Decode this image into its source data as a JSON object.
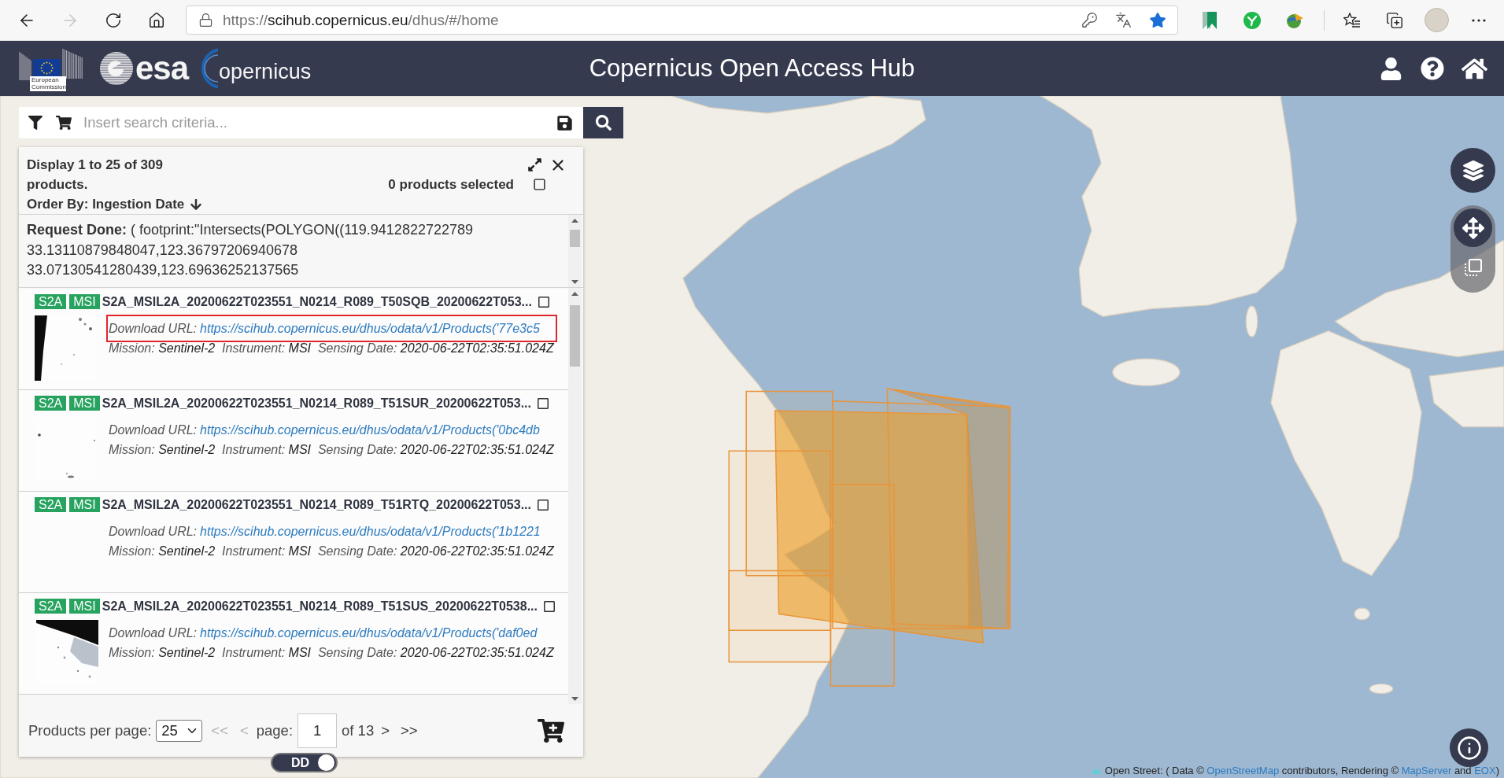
{
  "browser": {
    "back_disabled": false,
    "forward_disabled": true,
    "address": "https://**scihub.copernicus.eu**/dhus/#/home",
    "favorited": true
  },
  "header": {
    "ec_caption": "European Commission",
    "esa_wordmark": "esa",
    "copernicus_wordmark": "opernicus",
    "title": "Copernicus Open Access Hub"
  },
  "search": {
    "placeholder": "Insert search criteria..."
  },
  "results": {
    "summary": "Display 1 to 25 of 309 products.",
    "order_by": "Order By: Ingestion Date",
    "selected_count": "0 products selected",
    "select_all_checked": false,
    "request": "**Request Done:** ( footprint:\"Intersects(POLYGON((119.9412822722789 33.13110879848047,123.36797206940678 33.07130541280439,123.69636252137565",
    "products": [
      {
        "tags": [
          "S2A",
          "MSI"
        ],
        "name": "S2A_MSIL2A_20200622T023551_N0214_R089_T50SQB_20200622T053...",
        "checked": false,
        "thumbnail": {
          "kind": "left-strip"
        },
        "highlighted": true,
        "download_label": "Download URL:",
        "download_url": "https://scihub.copernicus.eu/dhus/odata/v1/Products('77e3c5",
        "details": "Mission: **Sentinel-2**  Instrument: **MSI**  Sensing Date: **2020-06-22T02:35:51.024Z**"
      },
      {
        "tags": [
          "S2A",
          "MSI"
        ],
        "name": "S2A_MSIL2A_20200622T023551_N0214_R089_T51SUR_20200622T053...",
        "checked": false,
        "thumbnail": {
          "kind": "specks"
        },
        "highlighted": false,
        "download_label": "Download URL:",
        "download_url": "https://scihub.copernicus.eu/dhus/odata/v1/Products('0bc4db",
        "details": "Mission: **Sentinel-2**  Instrument: **MSI**  Sensing Date: **2020-06-22T02:35:51.024Z**"
      },
      {
        "tags": [
          "S2A",
          "MSI"
        ],
        "name": "S2A_MSIL2A_20200622T023551_N0214_R089_T51RTQ_20200622T053...",
        "checked": false,
        "highlighted": false,
        "download_label": "Download URL:",
        "download_url": "https://scihub.copernicus.eu/dhus/odata/v1/Products('1b1221",
        "details": "Mission: **Sentinel-2**  Instrument: **MSI**  Sensing Date: **2020-06-22T02:35:51.024Z**"
      },
      {
        "tags": [
          "S2A",
          "MSI"
        ],
        "name": "S2A_MSIL2A_20200622T023551_N0214_R089_T51SUS_20200622T0538...",
        "checked": false,
        "thumbnail": {
          "kind": "top-corner"
        },
        "highlighted": false,
        "download_label": "Download URL:",
        "download_url": "https://scihub.copernicus.eu/dhus/odata/v1/Products('daf0ed",
        "details": "Mission: **Sentinel-2**  Instrument: **MSI**  Sensing Date: **2020-06-22T02:35:51.024Z**"
      }
    ]
  },
  "pagination": {
    "label": "Products per page:",
    "per_page": "25",
    "first": {
      "label": "<<",
      "disabled": true
    },
    "previous": {
      "label": "<",
      "disabled": true
    },
    "page_label": "page:",
    "page": "1",
    "total": "of 13",
    "next": {
      "label": ">",
      "disabled": false
    },
    "last": {
      "label": ">>",
      "disabled": false
    }
  },
  "coordinate_toggle": {
    "label": "DD",
    "on": true
  },
  "map": {
    "attribution": [
      {
        "text": "Open Street: ( Data © ",
        "link": false
      },
      {
        "text": "OpenStreetMap",
        "link": true
      },
      {
        "text": " contributors, Rendering © ",
        "link": false
      },
      {
        "text": "MapServer",
        "link": true
      },
      {
        "text": " and ",
        "link": false
      },
      {
        "text": "EOX",
        "link": true
      },
      {
        "text": ")",
        "link": false
      }
    ]
  }
}
